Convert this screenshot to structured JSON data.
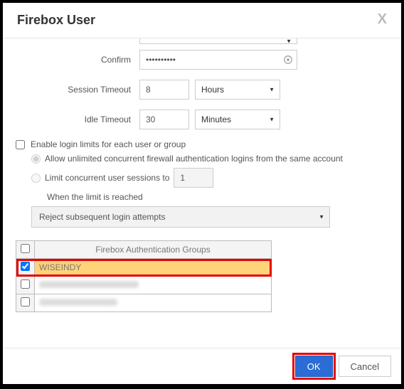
{
  "header": {
    "title": "Firebox User",
    "close": "X"
  },
  "form": {
    "confirm_label": "Confirm",
    "confirm_value": "••••••••••",
    "session_label": "Session Timeout",
    "session_value": "8",
    "session_unit": "Hours",
    "idle_label": "Idle Timeout",
    "idle_value": "30",
    "idle_unit": "Minutes"
  },
  "limits": {
    "enable_label": "Enable login limits for each user or group",
    "enable_checked": false,
    "allow_unlimited_label": "Allow unlimited concurrent firewall authentication logins from the same account",
    "limit_sessions_label": "Limit concurrent user sessions to",
    "limit_value": "1",
    "when_limit_label": "When the limit is reached",
    "action": "Reject subsequent login attempts"
  },
  "groups": {
    "header": "Firebox Authentication Groups",
    "rows": [
      {
        "checked": true,
        "name": "WISEINDY",
        "highlight": true
      },
      {
        "checked": false,
        "name": "",
        "highlight": false
      },
      {
        "checked": false,
        "name": "",
        "highlight": false
      }
    ]
  },
  "footer": {
    "ok": "OK",
    "cancel": "Cancel"
  }
}
